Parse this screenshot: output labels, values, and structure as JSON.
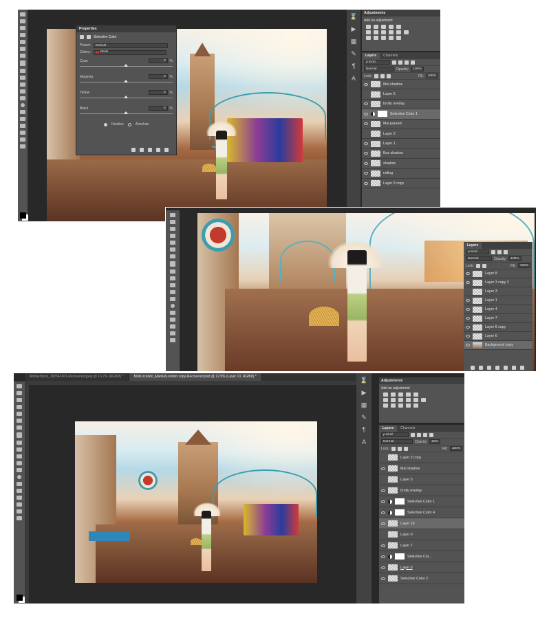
{
  "shot1": {
    "properties": {
      "title": "Properties",
      "adjustment_name": "Selective Color",
      "preset_label": "Preset:",
      "preset_value": "Default",
      "colors_label": "Colors:",
      "colors_value": "Reds",
      "sliders": [
        {
          "label": "Cyan",
          "value": "0"
        },
        {
          "label": "Magenta",
          "value": "0"
        },
        {
          "label": "Yellow",
          "value": "0"
        },
        {
          "label": "Black",
          "value": "0"
        }
      ],
      "pct": "%",
      "relative_label": "Relative",
      "absolute_label": "Absolute"
    },
    "adjustments": {
      "title": "Adjustments",
      "add_label": "Add an adjustment"
    },
    "layers": {
      "tab_layers": "Layers",
      "tab_channels": "Channels",
      "kind_label": "ρ Kind",
      "blend_mode": "Normal",
      "opacity_label": "Opacity:",
      "opacity_value": "100%",
      "lock_label": "Lock:",
      "fill_label": "Fill:",
      "fill_value": "100%",
      "items": [
        {
          "name": "Mal shadow"
        },
        {
          "name": "Layer 5"
        },
        {
          "name": "brolly overlay"
        },
        {
          "name": "Selective Color 1"
        },
        {
          "name": "Mal parasol"
        },
        {
          "name": "Layer 2"
        },
        {
          "name": "Layer 1"
        },
        {
          "name": "Bus shadow"
        },
        {
          "name": "shadow"
        },
        {
          "name": "railing"
        },
        {
          "name": "Layer 6 copy"
        }
      ]
    }
  },
  "shot2": {
    "layers": {
      "tab_layers": "Layers",
      "kind_label": "ρ Kind",
      "blend_mode": "Normal",
      "opacity_label": "Opacity:",
      "opacity_value": "100%",
      "lock_label": "Lock:",
      "fill_label": "Fill:",
      "fill_value": "100%",
      "items": [
        {
          "name": "Layer 8"
        },
        {
          "name": "Layer 3 copy 2"
        },
        {
          "name": "Layer 3"
        },
        {
          "name": "Layer 1"
        },
        {
          "name": "Layer 4"
        },
        {
          "name": "Layer 7"
        },
        {
          "name": "Layer 6 copy"
        },
        {
          "name": "Layer 6"
        },
        {
          "name": "Background copy"
        }
      ]
    }
  },
  "shot3": {
    "tabs": [
      {
        "label": "AdobeStock_182542461-Recovered.jpeg @ 16.7% (RGB/8) *"
      },
      {
        "label": "Multi.ocation_Manila\\London copy-Recovered.psd @ 12.5% (Layer 10, RGB/8) *"
      }
    ],
    "adjustments": {
      "title": "Adjustments",
      "add_label": "Add an adjustment"
    },
    "layers": {
      "tab_layers": "Layers",
      "tab_channels": "Channels",
      "kind_label": "ρ Kind",
      "blend_mode": "Normal",
      "opacity_label": "Opacity:",
      "opacity_value": "20%",
      "lock_label": "Lock:",
      "fill_label": "Fill:",
      "fill_value": "100%",
      "items": [
        {
          "name": "Layer 2 copy"
        },
        {
          "name": "Mal shadow"
        },
        {
          "name": "Layer 5"
        },
        {
          "name": "brolly overlay"
        },
        {
          "name": "Selective Color 1"
        },
        {
          "name": "Selective Color 4"
        },
        {
          "name": "Layer 10"
        },
        {
          "name": "Layer 9"
        },
        {
          "name": "Layer 7"
        },
        {
          "name": "Selective Col..."
        },
        {
          "name": "Layer 6"
        },
        {
          "name": "Selective Color 2"
        }
      ]
    }
  }
}
